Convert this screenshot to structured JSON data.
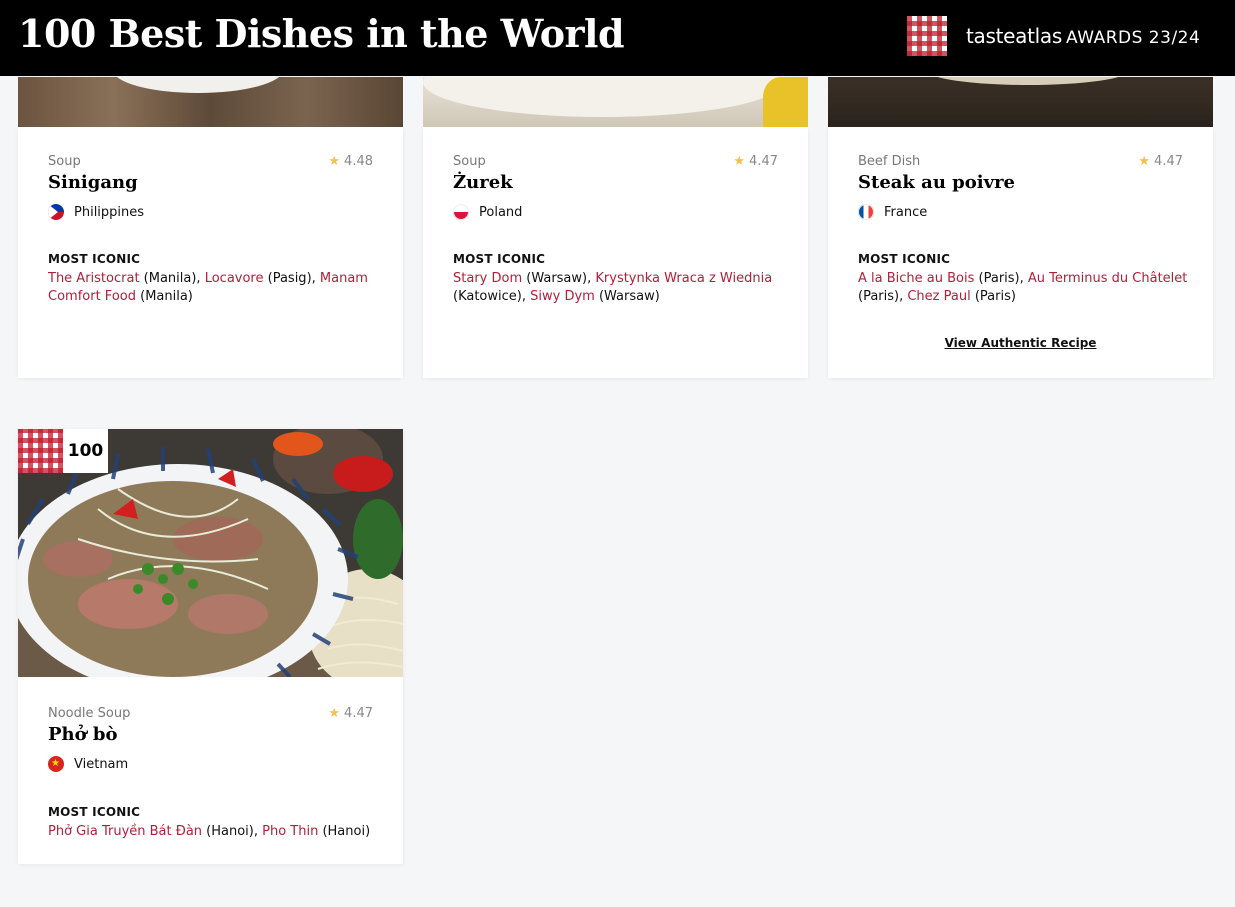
{
  "header": {
    "title": "100 Best Dishes in the World",
    "brand_name": "tasteatlas",
    "brand_awards": "AWARDS 23/24"
  },
  "cards": [
    {
      "category": "Soup",
      "rating": "4.48",
      "name": "Sinigang",
      "country": "Philippines",
      "most_iconic_label": "MOST ICONIC",
      "places": [
        {
          "name": "The Aristocrat",
          "loc": " (Manila), "
        },
        {
          "name": "Locavore",
          "loc": " (Pasig), "
        },
        {
          "name": "Manam Comfort Food",
          "loc": " (Manila)"
        }
      ]
    },
    {
      "category": "Soup",
      "rating": "4.47",
      "name": "Żurek",
      "country": "Poland",
      "most_iconic_label": "MOST ICONIC",
      "places": [
        {
          "name": "Stary Dom",
          "loc": " (Warsaw), "
        },
        {
          "name": "Krystynka Wraca z Wiednia",
          "loc": " (Katowice), "
        },
        {
          "name": "Siwy Dym",
          "loc": " (Warsaw)"
        }
      ]
    },
    {
      "category": "Beef Dish",
      "rating": "4.47",
      "name": "Steak au poivre",
      "country": "France",
      "most_iconic_label": "MOST ICONIC",
      "places": [
        {
          "name": "A la Biche au Bois",
          "loc": " (Paris), "
        },
        {
          "name": "Au Terminus du Châtelet",
          "loc": " (Paris), "
        },
        {
          "name": "Chez Paul",
          "loc": " (Paris)"
        }
      ],
      "recipe_link": "View Authentic Recipe"
    },
    {
      "rank": "100",
      "category": "Noodle Soup",
      "rating": "4.47",
      "name": "Phở bò",
      "country": "Vietnam",
      "most_iconic_label": "MOST ICONIC",
      "places": [
        {
          "name": "Phở Gia Truyền Bát Đàn",
          "loc": " (Hanoi), "
        },
        {
          "name": "Pho Thin",
          "loc": " (Hanoi)"
        }
      ]
    }
  ],
  "colors": {
    "header_bg": "#000000",
    "link": "#b0203a",
    "star": "#f2c14e",
    "page_bg": "#f5f6f8"
  }
}
